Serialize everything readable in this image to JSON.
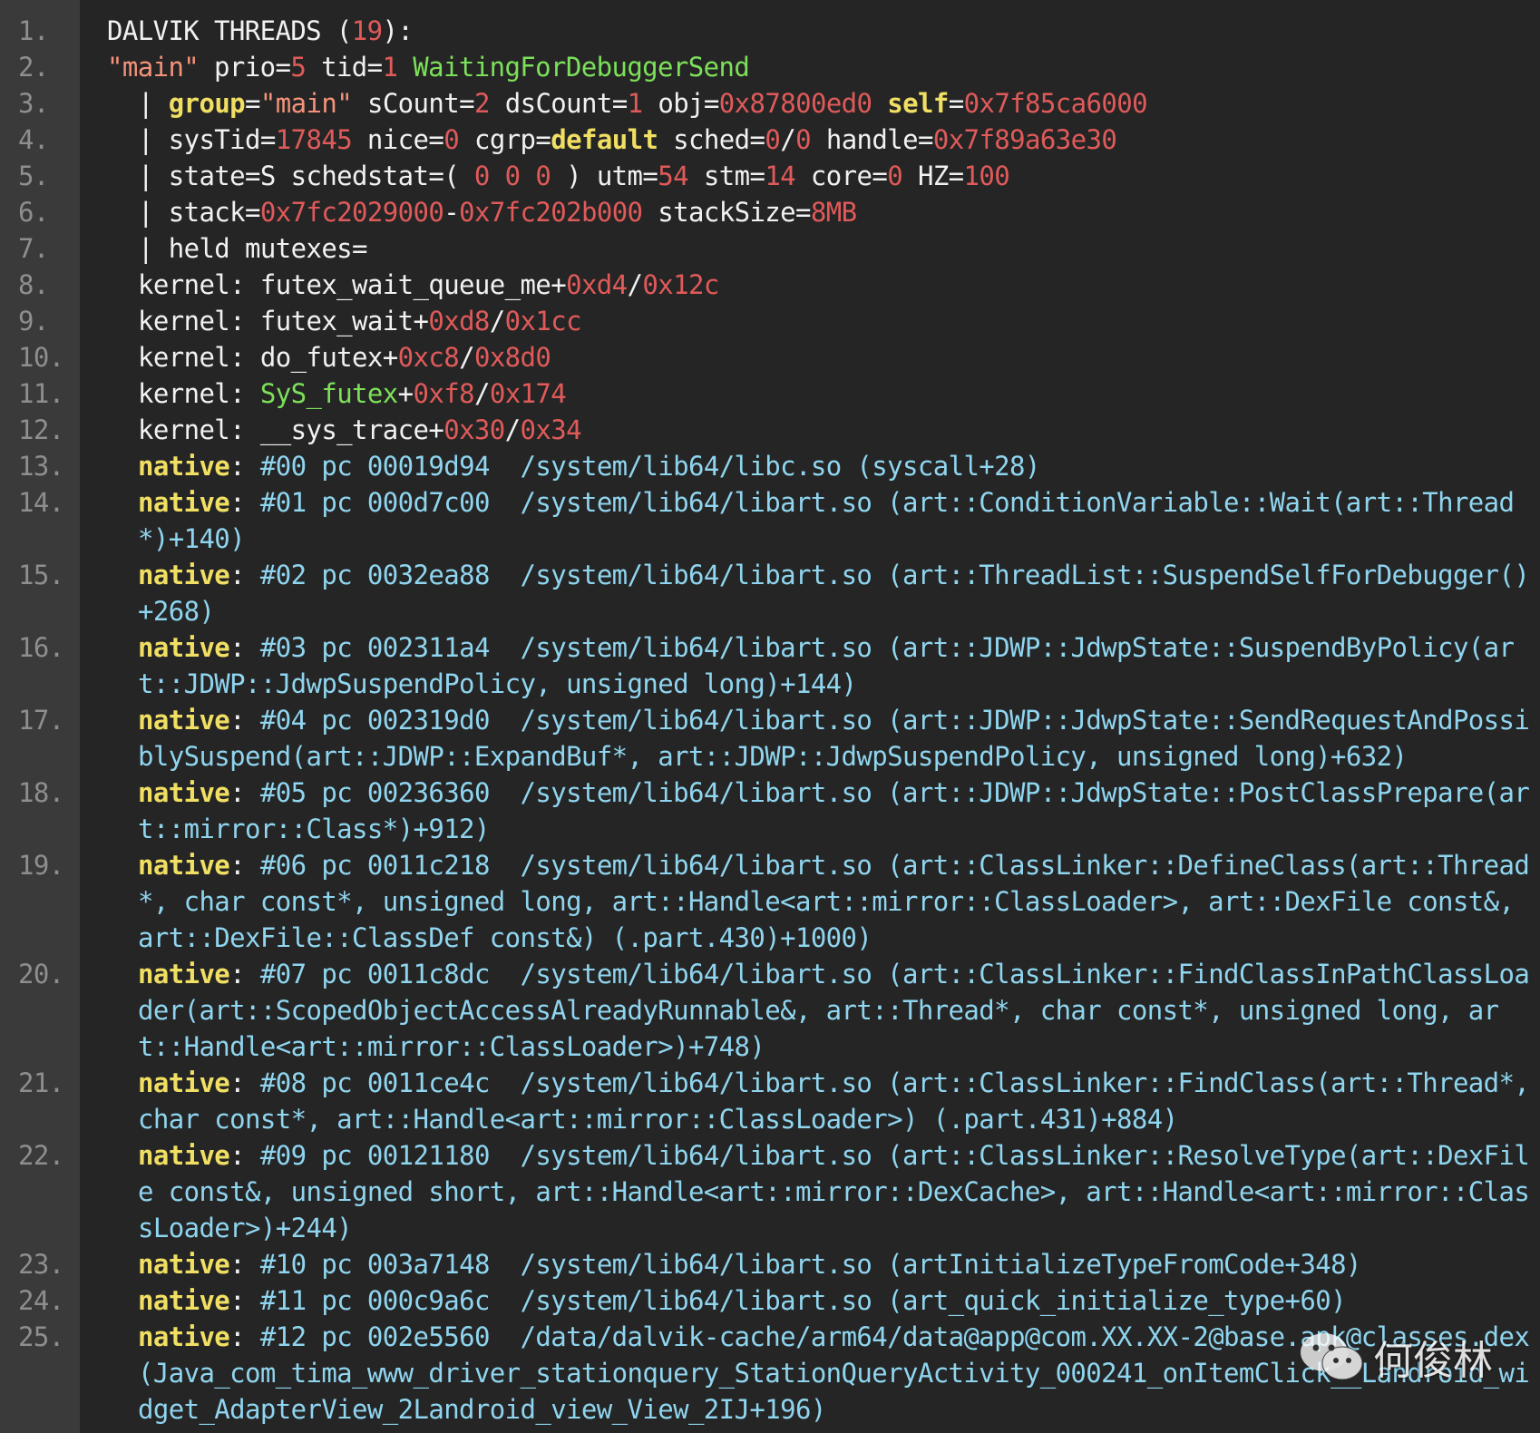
{
  "colors": {
    "background": "#252525",
    "gutter": "#3a3a3a",
    "line_number": "#8e8e8e",
    "plain": "#f1f1f1",
    "number": "#e05a5a",
    "keyword": "#f0df62",
    "state": "#7ce05a",
    "symbol": "#8fd5ef"
  },
  "lines": [
    {
      "n": "1.",
      "indent": 0,
      "parts": [
        [
          "w",
          "DALVIK THREADS ("
        ],
        [
          "r",
          "19"
        ],
        [
          "w",
          "):"
        ]
      ]
    },
    {
      "n": "2.",
      "indent": 0,
      "parts": [
        [
          "s",
          "\"main\""
        ],
        [
          "w",
          " prio="
        ],
        [
          "r",
          "5"
        ],
        [
          "w",
          " tid="
        ],
        [
          "r",
          "1"
        ],
        [
          "w",
          " "
        ],
        [
          "g",
          "WaitingForDebuggerSend"
        ]
      ]
    },
    {
      "n": "3.",
      "indent": 1,
      "parts": [
        [
          "w",
          "| "
        ],
        [
          "y",
          "group"
        ],
        [
          "w",
          "="
        ],
        [
          "s",
          "\"main\""
        ],
        [
          "w",
          " sCount="
        ],
        [
          "r",
          "2"
        ],
        [
          "w",
          " dsCount="
        ],
        [
          "r",
          "1"
        ],
        [
          "w",
          " obj="
        ],
        [
          "r",
          "0x87800ed0"
        ],
        [
          "w",
          " "
        ],
        [
          "y",
          "self"
        ],
        [
          "w",
          "="
        ],
        [
          "r",
          "0x7f85ca6000"
        ]
      ]
    },
    {
      "n": "4.",
      "indent": 1,
      "parts": [
        [
          "w",
          "| sysTid="
        ],
        [
          "r",
          "17845"
        ],
        [
          "w",
          " nice="
        ],
        [
          "r",
          "0"
        ],
        [
          "w",
          " cgrp="
        ],
        [
          "y",
          "default"
        ],
        [
          "w",
          " sched="
        ],
        [
          "r",
          "0"
        ],
        [
          "w",
          "/"
        ],
        [
          "r",
          "0"
        ],
        [
          "w",
          " handle="
        ],
        [
          "r",
          "0x7f89a63e30"
        ]
      ]
    },
    {
      "n": "5.",
      "indent": 1,
      "parts": [
        [
          "w",
          "| state=S schedstat=( "
        ],
        [
          "r",
          "0 0 0"
        ],
        [
          "w",
          " ) utm="
        ],
        [
          "r",
          "54"
        ],
        [
          "w",
          " stm="
        ],
        [
          "r",
          "14"
        ],
        [
          "w",
          " core="
        ],
        [
          "r",
          "0"
        ],
        [
          "w",
          " HZ="
        ],
        [
          "r",
          "100"
        ]
      ]
    },
    {
      "n": "6.",
      "indent": 1,
      "parts": [
        [
          "w",
          "| stack="
        ],
        [
          "r",
          "0x7fc2029000"
        ],
        [
          "w",
          "-"
        ],
        [
          "r",
          "0x7fc202b000"
        ],
        [
          "w",
          " stackSize="
        ],
        [
          "r",
          "8MB"
        ]
      ]
    },
    {
      "n": "7.",
      "indent": 1,
      "parts": [
        [
          "w",
          "| held mutexes="
        ]
      ]
    },
    {
      "n": "8.",
      "indent": 2,
      "parts": [
        [
          "w",
          "kernel: futex_wait_queue_me+"
        ],
        [
          "r",
          "0xd4"
        ],
        [
          "w",
          "/"
        ],
        [
          "r",
          "0x12c"
        ]
      ]
    },
    {
      "n": "9.",
      "indent": 2,
      "parts": [
        [
          "w",
          "kernel: futex_wait+"
        ],
        [
          "r",
          "0xd8"
        ],
        [
          "w",
          "/"
        ],
        [
          "r",
          "0x1cc"
        ]
      ]
    },
    {
      "n": "10.",
      "indent": 2,
      "parts": [
        [
          "w",
          "kernel: do_futex+"
        ],
        [
          "r",
          "0xc8"
        ],
        [
          "w",
          "/"
        ],
        [
          "r",
          "0x8d0"
        ]
      ]
    },
    {
      "n": "11.",
      "indent": 2,
      "parts": [
        [
          "w",
          "kernel: "
        ],
        [
          "g",
          "SyS_futex"
        ],
        [
          "w",
          "+"
        ],
        [
          "r",
          "0xf8"
        ],
        [
          "w",
          "/"
        ],
        [
          "r",
          "0x174"
        ]
      ]
    },
    {
      "n": "12.",
      "indent": 2,
      "parts": [
        [
          "w",
          "kernel: __sys_trace+"
        ],
        [
          "r",
          "0x30"
        ],
        [
          "w",
          "/"
        ],
        [
          "r",
          "0x34"
        ]
      ]
    },
    {
      "n": "13.",
      "indent": 2,
      "parts": [
        [
          "y",
          "native"
        ],
        [
          "w",
          ": "
        ],
        [
          "b",
          "#00 pc 00019d94  /system/lib64/libc.so (syscall+28)"
        ]
      ]
    },
    {
      "n": "14.",
      "indent": 2,
      "parts": [
        [
          "y",
          "native"
        ],
        [
          "w",
          ": "
        ],
        [
          "b",
          "#01 pc 000d7c00  /system/lib64/libart.so (art::ConditionVariable::Wait(art::Thread*)+140)"
        ]
      ]
    },
    {
      "n": "15.",
      "indent": 2,
      "parts": [
        [
          "y",
          "native"
        ],
        [
          "w",
          ": "
        ],
        [
          "b",
          "#02 pc 0032ea88  /system/lib64/libart.so (art::ThreadList::SuspendSelfForDebugger()+268)"
        ]
      ]
    },
    {
      "n": "16.",
      "indent": 2,
      "parts": [
        [
          "y",
          "native"
        ],
        [
          "w",
          ": "
        ],
        [
          "b",
          "#03 pc 002311a4  /system/lib64/libart.so (art::JDWP::JdwpState::SuspendByPolicy(art::JDWP::JdwpSuspendPolicy, unsigned long)+144)"
        ]
      ]
    },
    {
      "n": "17.",
      "indent": 2,
      "parts": [
        [
          "y",
          "native"
        ],
        [
          "w",
          ": "
        ],
        [
          "b",
          "#04 pc 002319d0  /system/lib64/libart.so (art::JDWP::JdwpState::SendRequestAndPossiblySuspend(art::JDWP::ExpandBuf*, art::JDWP::JdwpSuspendPolicy, unsigned long)+632)"
        ]
      ]
    },
    {
      "n": "18.",
      "indent": 2,
      "parts": [
        [
          "y",
          "native"
        ],
        [
          "w",
          ": "
        ],
        [
          "b",
          "#05 pc 00236360  /system/lib64/libart.so (art::JDWP::JdwpState::PostClassPrepare(art::mirror::Class*)+912)"
        ]
      ]
    },
    {
      "n": "19.",
      "indent": 2,
      "parts": [
        [
          "y",
          "native"
        ],
        [
          "w",
          ": "
        ],
        [
          "b",
          "#06 pc 0011c218  /system/lib64/libart.so (art::ClassLinker::DefineClass(art::Thread*, char const*, unsigned long, art::Handle<art::mirror::ClassLoader>, art::DexFile const&, art::DexFile::ClassDef const&) (.part.430)+1000)"
        ]
      ]
    },
    {
      "n": "20.",
      "indent": 2,
      "parts": [
        [
          "y",
          "native"
        ],
        [
          "w",
          ": "
        ],
        [
          "b",
          "#07 pc 0011c8dc  /system/lib64/libart.so (art::ClassLinker::FindClassInPathClassLoader(art::ScopedObjectAccessAlreadyRunnable&, art::Thread*, char const*, unsigned long, art::Handle<art::mirror::ClassLoader>)+748)"
        ]
      ]
    },
    {
      "n": "21.",
      "indent": 2,
      "parts": [
        [
          "y",
          "native"
        ],
        [
          "w",
          ": "
        ],
        [
          "b",
          "#08 pc 0011ce4c  /system/lib64/libart.so (art::ClassLinker::FindClass(art::Thread*, char const*, art::Handle<art::mirror::ClassLoader>) (.part.431)+884)"
        ]
      ]
    },
    {
      "n": "22.",
      "indent": 2,
      "parts": [
        [
          "y",
          "native"
        ],
        [
          "w",
          ": "
        ],
        [
          "b",
          "#09 pc 00121180  /system/lib64/libart.so (art::ClassLinker::ResolveType(art::DexFile const&, unsigned short, art::Handle<art::mirror::DexCache>, art::Handle<art::mirror::ClassLoader>)+244)"
        ]
      ]
    },
    {
      "n": "23.",
      "indent": 2,
      "parts": [
        [
          "y",
          "native"
        ],
        [
          "w",
          ": "
        ],
        [
          "b",
          "#10 pc 003a7148  /system/lib64/libart.so (artInitializeTypeFromCode+348)"
        ]
      ]
    },
    {
      "n": "24.",
      "indent": 2,
      "parts": [
        [
          "y",
          "native"
        ],
        [
          "w",
          ": "
        ],
        [
          "b",
          "#11 pc 000c9a6c  /system/lib64/libart.so (art_quick_initialize_type+60)"
        ]
      ]
    },
    {
      "n": "25.",
      "indent": 2,
      "parts": [
        [
          "y",
          "native"
        ],
        [
          "w",
          ": "
        ],
        [
          "b",
          "#12 pc 002e5560  /data/dalvik-cache/arm64/data@app@com.XX.XX-2@base.apk@classes.dex (Java_com_tima_www_driver_stationquery_StationQueryActivity_000241_onItemClick__Landroid_widget_AdapterView_2Landroid_view_View_2IJ+196)"
        ]
      ]
    }
  ],
  "watermark": {
    "icon": "wechat-icon",
    "text": "何俊林"
  }
}
